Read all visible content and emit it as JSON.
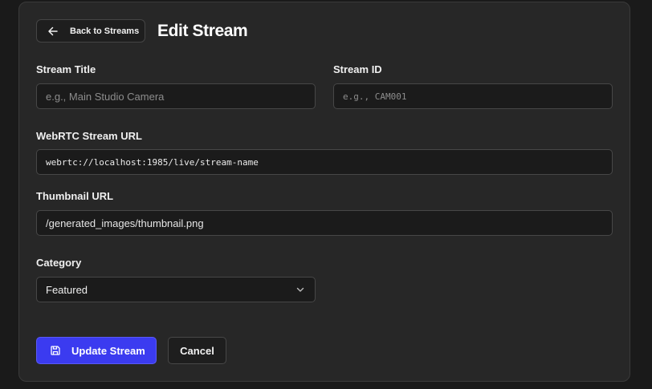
{
  "header": {
    "back_label": "Back to Streams",
    "title": "Edit Stream"
  },
  "form": {
    "title_field": {
      "label": "Stream Title",
      "placeholder": "e.g., Main Studio Camera",
      "value": ""
    },
    "id_field": {
      "label": "Stream ID",
      "placeholder": "e.g., CAM001",
      "value": ""
    },
    "url_field": {
      "label": "WebRTC Stream URL",
      "placeholder": "",
      "value": "webrtc://localhost:1985/live/stream-name"
    },
    "thumb_field": {
      "label": "Thumbnail URL",
      "placeholder": "",
      "value": "/generated_images/thumbnail.png"
    },
    "category": {
      "label": "Category",
      "selected": "Featured"
    }
  },
  "actions": {
    "submit_label": "Update Stream",
    "cancel_label": "Cancel"
  },
  "colors": {
    "primary": "#3b3bf0",
    "card_bg": "#272727",
    "page_bg": "#1a1a1a"
  },
  "icons": {
    "back": "arrow-left-icon",
    "chevron": "chevron-down-icon",
    "save": "save-icon"
  }
}
